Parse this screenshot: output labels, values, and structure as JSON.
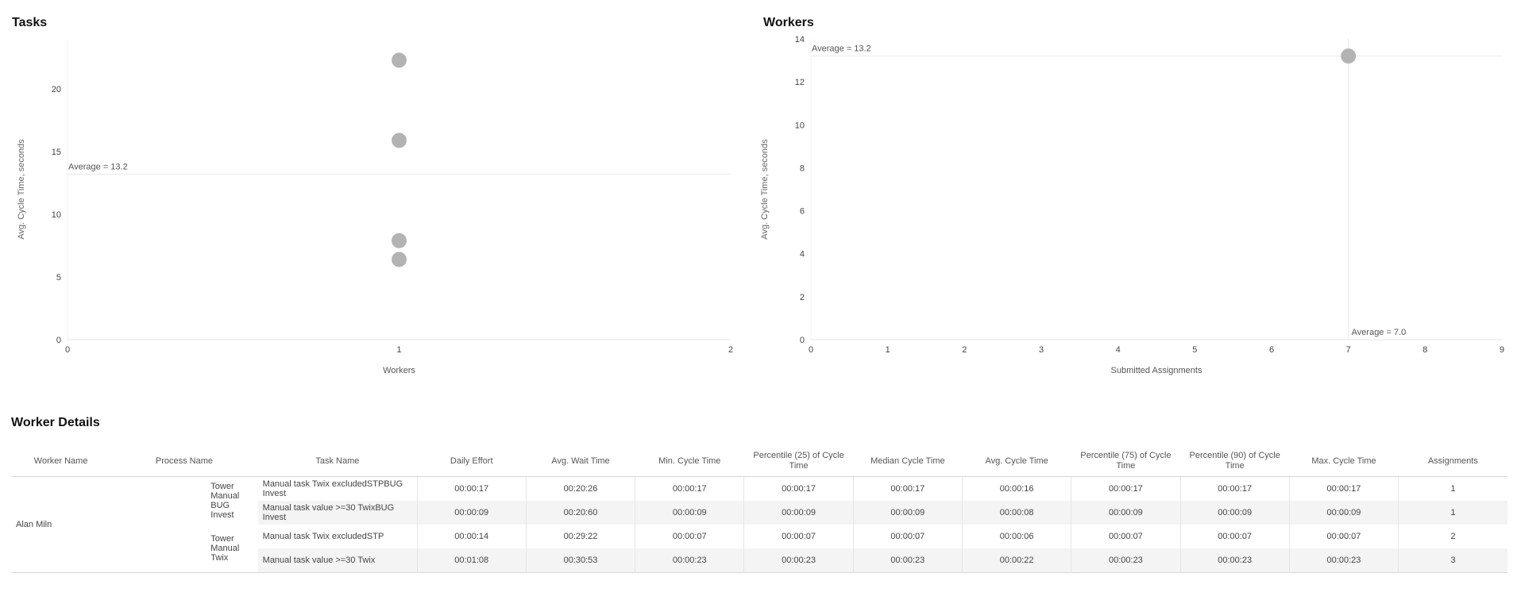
{
  "tasks_panel": {
    "title": "Tasks"
  },
  "workers_panel": {
    "title": "Workers"
  },
  "chart_data": [
    {
      "type": "scatter",
      "title": "Tasks",
      "xlabel": "Workers",
      "ylabel": "Avg. Cycle Time, seconds",
      "xlim": [
        0,
        2
      ],
      "ylim": [
        0,
        24
      ],
      "x_ticks": [
        "0",
        "1",
        "2"
      ],
      "y_ticks": [
        "0",
        "5",
        "10",
        "15",
        "20"
      ],
      "points": [
        {
          "x": 1,
          "y": 22.3
        },
        {
          "x": 1,
          "y": 15.9
        },
        {
          "x": 1,
          "y": 7.9
        },
        {
          "x": 1,
          "y": 6.4
        }
      ],
      "average_line": {
        "value": 13.2,
        "label": "Average = 13.2"
      },
      "color": "#b3b3b3"
    },
    {
      "type": "scatter",
      "title": "Workers",
      "xlabel": "Submitted Assignments",
      "ylabel": "Avg. Cycle Time, seconds",
      "xlim": [
        0,
        9
      ],
      "ylim": [
        0,
        14
      ],
      "x_ticks": [
        "0",
        "1",
        "2",
        "3",
        "4",
        "5",
        "6",
        "7",
        "8",
        "9"
      ],
      "y_ticks": [
        "0",
        "2",
        "4",
        "6",
        "8",
        "10",
        "12",
        "14"
      ],
      "points": [
        {
          "x": 7,
          "y": 13.2
        }
      ],
      "average_line_y": {
        "value": 13.2,
        "label": "Average = 13.2"
      },
      "average_line_x": {
        "value": 7.0,
        "label": "Average = 7.0"
      },
      "color": "#b3b3b3"
    }
  ],
  "details": {
    "title": "Worker Details",
    "columns": [
      "Worker Name",
      "Process Name",
      "Task Name",
      "Daily Effort",
      "Avg. Wait Time",
      "Min. Cycle Time",
      "Percentile (25) of Cycle Time",
      "Median Cycle Time",
      "Avg. Cycle Time",
      "Percentile (75) of Cycle Time",
      "Percentile (90) of Cycle Time",
      "Max. Cycle Time",
      "Assignments"
    ],
    "worker": "Alan Miln",
    "processes": [
      "Tower Manual BUG Invest",
      "Tower Manual Twix"
    ],
    "rows": [
      {
        "task": "Manual task Twix excludedSTPBUG Invest",
        "values": [
          "00:00:17",
          "00:20:26",
          "00:00:17",
          "00:00:17",
          "00:00:17",
          "00:00:16",
          "00:00:17",
          "00:00:17",
          "00:00:17",
          "1"
        ]
      },
      {
        "task": "Manual task value >=30 TwixBUG Invest",
        "values": [
          "00:00:09",
          "00:20:60",
          "00:00:09",
          "00:00:09",
          "00:00:09",
          "00:00:08",
          "00:00:09",
          "00:00:09",
          "00:00:09",
          "1"
        ]
      },
      {
        "task": "Manual task Twix excludedSTP",
        "values": [
          "00:00:14",
          "00:29:22",
          "00:00:07",
          "00:00:07",
          "00:00:07",
          "00:00:06",
          "00:00:07",
          "00:00:07",
          "00:00:07",
          "2"
        ]
      },
      {
        "task": "Manual task value >=30 Twix",
        "values": [
          "00:01:08",
          "00:30:53",
          "00:00:23",
          "00:00:23",
          "00:00:23",
          "00:00:22",
          "00:00:23",
          "00:00:23",
          "00:00:23",
          "3"
        ]
      }
    ]
  }
}
